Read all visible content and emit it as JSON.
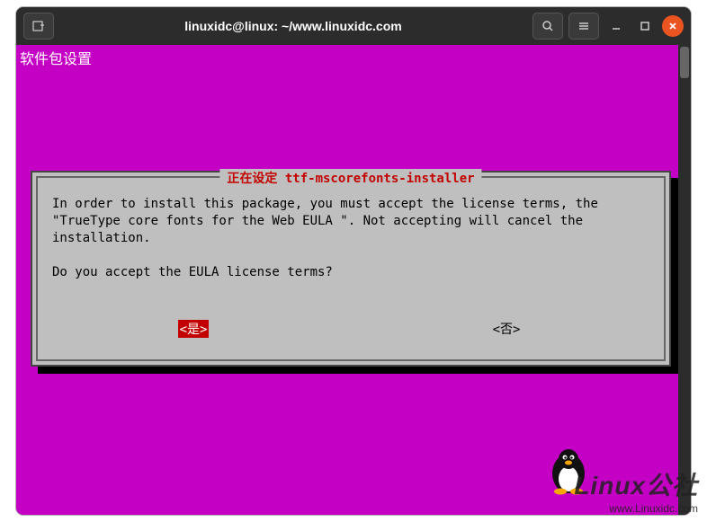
{
  "titlebar": {
    "title": "linuxidc@linux: ~/www.linuxidc.com"
  },
  "terminal": {
    "header": "软件包设置"
  },
  "dialog": {
    "title": "正在设定 ttf-mscorefonts-installer",
    "body_line1": "In order to install this package, you must accept the license terms, the \"TrueType core fonts for the Web EULA \". Not accepting will cancel the installation.",
    "body_line2": "Do you accept the EULA license terms?",
    "yes": "<是>",
    "no": "<否>"
  },
  "watermark": {
    "main": "Linux公社",
    "sub": "www.Linuxidc.com"
  }
}
